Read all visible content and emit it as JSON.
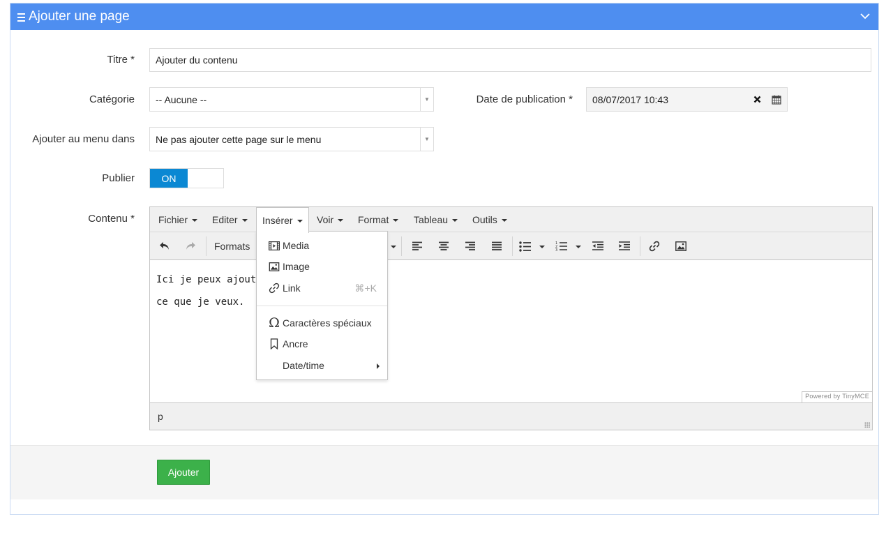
{
  "header": {
    "title": "Ajouter une page"
  },
  "form": {
    "title_label": "Titre *",
    "title_value": "Ajouter du contenu",
    "category_label": "Catégorie",
    "category_value": "-- Aucune --",
    "pub_date_label": "Date de publication *",
    "pub_date_value": "08/07/2017 10:43",
    "menu_label": "Ajouter au menu dans",
    "menu_value": "Ne pas ajouter cette page sur le menu",
    "publish_label": "Publier",
    "publish_state": "ON",
    "content_label": "Contenu *"
  },
  "editor": {
    "menus": [
      "Fichier",
      "Editer",
      "Insérer",
      "Voir",
      "Format",
      "Tableau",
      "Outils"
    ],
    "active_menu": "Insérer",
    "formats_label": "Formats",
    "content_lines": [
      "Ici je peux ajouter",
      "ce que je veux."
    ],
    "powered_by": "Powered by TinyMCE",
    "status_path": "p",
    "insert_menu": {
      "items": [
        {
          "label": "Media",
          "icon": "media-icon"
        },
        {
          "label": "Image",
          "icon": "image-icon"
        },
        {
          "label": "Link",
          "icon": "link-icon",
          "shortcut": "⌘+K"
        },
        {
          "label": "Caractères spéciaux",
          "icon": "omega-icon"
        },
        {
          "label": "Ancre",
          "icon": "bookmark-icon"
        },
        {
          "label": "Date/time",
          "icon": ""
        }
      ]
    }
  },
  "footer": {
    "submit_label": "Ajouter"
  },
  "colors": {
    "header": "#4e8ef0",
    "toggle_on": "#0b88d3",
    "submit": "#3cb14a"
  }
}
